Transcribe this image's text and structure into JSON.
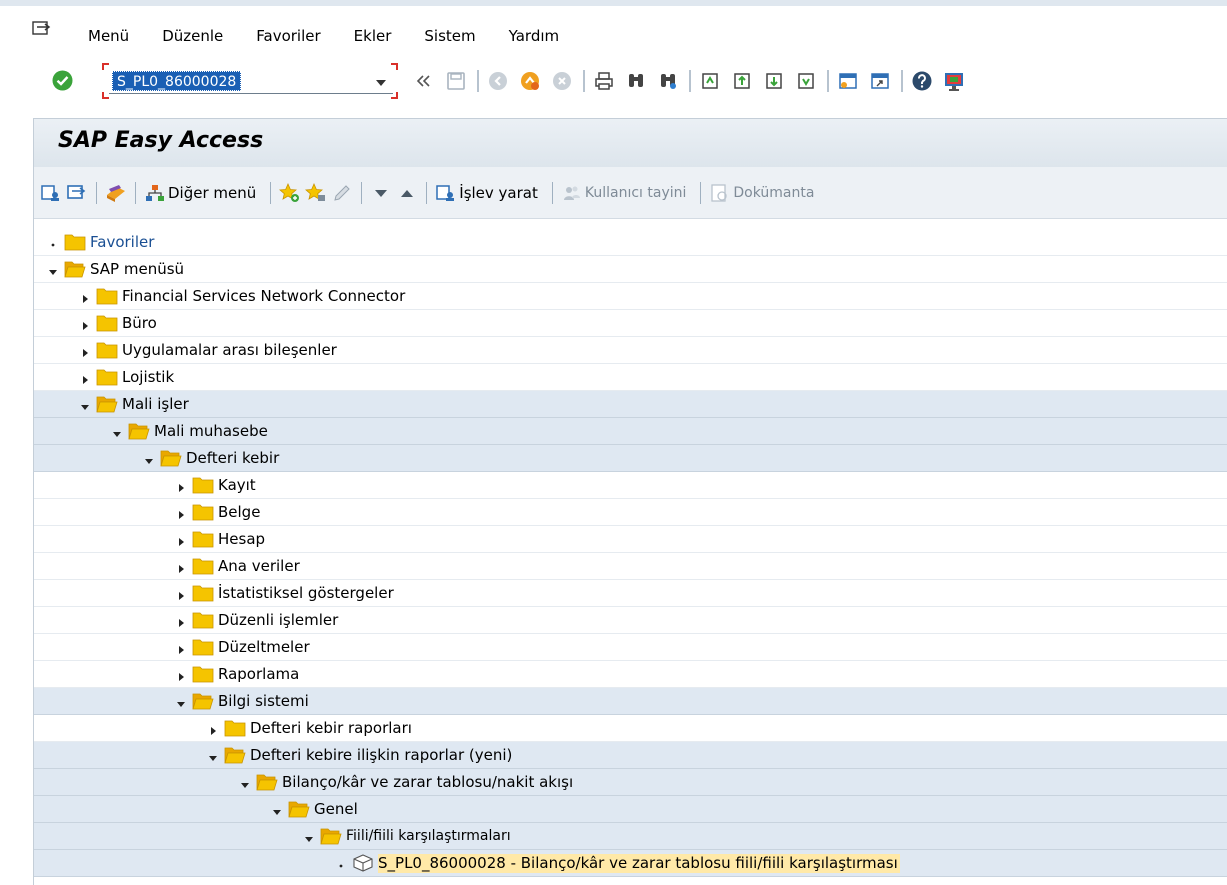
{
  "menubar": {
    "items": [
      {
        "label": "Menü"
      },
      {
        "label": "Düzenle"
      },
      {
        "label": "Favoriler"
      },
      {
        "label": "Ekler"
      },
      {
        "label": "Sistem"
      },
      {
        "label": "Yardım"
      }
    ]
  },
  "toolbar": {
    "command_value": "S_PL0_86000028"
  },
  "page": {
    "title": "SAP Easy Access"
  },
  "app_toolbar": {
    "other_menu_label": "Diğer menü",
    "create_function_label": "İşlev yarat",
    "user_assignment_label": "Kullanıcı tayini",
    "documentation_label": "Dokümanta"
  },
  "tree": [
    {
      "label": "Favoriler",
      "level": 0,
      "state": "leaf",
      "style": "link"
    },
    {
      "label": "SAP menüsü",
      "level": 0,
      "state": "expanded",
      "style": "normal"
    },
    {
      "label": "Financial Services Network Connector",
      "level": 1,
      "state": "collapsed",
      "style": "normal"
    },
    {
      "label": "Büro",
      "level": 1,
      "state": "collapsed",
      "style": "normal"
    },
    {
      "label": "Uygulamalar arası bileşenler",
      "level": 1,
      "state": "collapsed",
      "style": "normal"
    },
    {
      "label": "Lojistik",
      "level": 1,
      "state": "collapsed",
      "style": "normal"
    },
    {
      "label": "Mali işler",
      "level": 1,
      "state": "expanded",
      "style": "normal"
    },
    {
      "label": "Mali muhasebe",
      "level": 2,
      "state": "expanded",
      "style": "normal"
    },
    {
      "label": "Defteri kebir",
      "level": 3,
      "state": "expanded",
      "style": "normal"
    },
    {
      "label": "Kayıt",
      "level": 4,
      "state": "collapsed",
      "style": "normal"
    },
    {
      "label": "Belge",
      "level": 4,
      "state": "collapsed",
      "style": "normal"
    },
    {
      "label": "Hesap",
      "level": 4,
      "state": "collapsed",
      "style": "normal"
    },
    {
      "label": "Ana veriler",
      "level": 4,
      "state": "collapsed",
      "style": "normal"
    },
    {
      "label": "İstatistiksel göstergeler",
      "level": 4,
      "state": "collapsed",
      "style": "normal"
    },
    {
      "label": "Düzenli işlemler",
      "level": 4,
      "state": "collapsed",
      "style": "normal"
    },
    {
      "label": "Düzeltmeler",
      "level": 4,
      "state": "collapsed",
      "style": "normal"
    },
    {
      "label": "Raporlama",
      "level": 4,
      "state": "collapsed",
      "style": "normal"
    },
    {
      "label": "Bilgi sistemi",
      "level": 4,
      "state": "expanded",
      "style": "normal"
    },
    {
      "label": "Defteri kebir raporları",
      "level": 5,
      "state": "collapsed",
      "style": "normal"
    },
    {
      "label": "Defteri kebire ilişkin raporlar (yeni)",
      "level": 5,
      "state": "expanded",
      "style": "normal"
    },
    {
      "label": "Bilanço/kâr ve zarar tablosu/nakit akışı",
      "level": 6,
      "state": "expanded",
      "style": "normal"
    },
    {
      "label": "Genel",
      "level": 7,
      "state": "expanded",
      "style": "normal"
    },
    {
      "label": "Fiili/fiili karşılaştırmaları",
      "level": 8,
      "state": "expanded",
      "style": "small"
    },
    {
      "label": "S_PL0_86000028 - Bilanço/kâr ve zarar tablosu fiili/fiili karşılaştırması",
      "level": 9,
      "state": "transaction",
      "style": "selected"
    }
  ],
  "colors": {
    "folder": "#f5c400",
    "selection": "#ffe9a8",
    "tree_band": "#dfe8f2",
    "command_highlight": "#1a5fb4",
    "ok_green": "#3aa33a",
    "link": "#1a4f93"
  }
}
